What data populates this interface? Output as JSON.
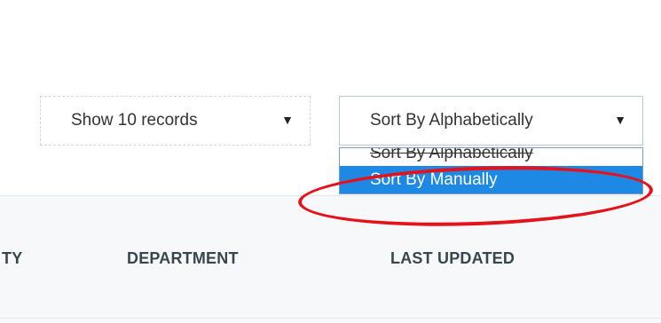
{
  "controls": {
    "records_select": {
      "value": "Show 10 records",
      "arrow": "▼"
    },
    "sort_select": {
      "value": "Sort By Alphabetically",
      "arrow": "▼"
    }
  },
  "sort_dropdown": {
    "options": [
      {
        "label": "Sort By Alphabetically",
        "selected": false
      },
      {
        "label": "Sort By Manually",
        "selected": true
      }
    ]
  },
  "table": {
    "columns": [
      "TY",
      "DEPARTMENT",
      "LAST UPDATED"
    ]
  },
  "colors": {
    "highlight": "#1e88e5",
    "annotation": "#e5121b",
    "header_bg": "#f6f8fa"
  }
}
